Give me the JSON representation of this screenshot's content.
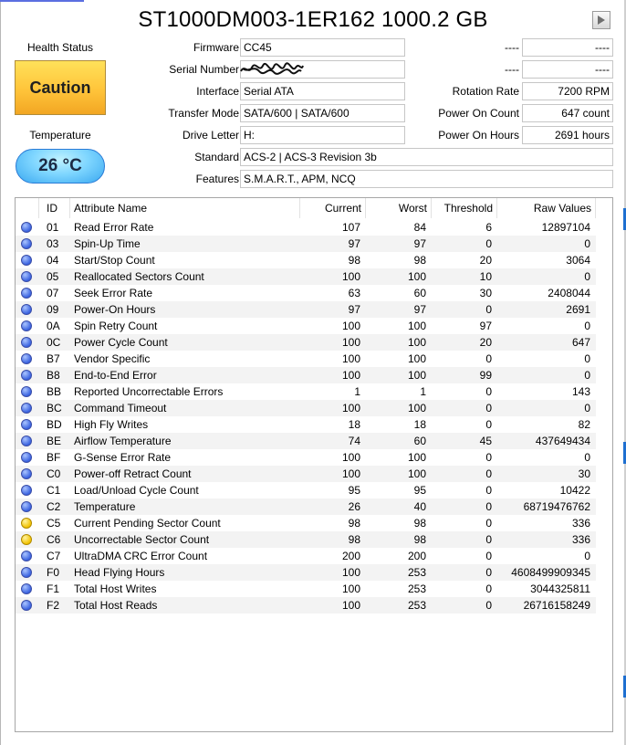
{
  "title": "ST1000DM003-1ER162 1000.2 GB",
  "health": {
    "label": "Health Status",
    "status": "Caution",
    "color": "#ffc43a"
  },
  "temperature": {
    "label": "Temperature",
    "value": "26 °C"
  },
  "info": {
    "firmware": {
      "label": "Firmware",
      "value": "CC45"
    },
    "serial": {
      "label": "Serial Number",
      "value": ""
    },
    "interface": {
      "label": "Interface",
      "value": "Serial ATA"
    },
    "transfer_mode": {
      "label": "Transfer Mode",
      "value": "SATA/600 | SATA/600"
    },
    "drive_letter": {
      "label": "Drive Letter",
      "value": "H:"
    },
    "standard": {
      "label": "Standard",
      "value": "ACS-2 | ACS-3 Revision 3b"
    },
    "features": {
      "label": "Features",
      "value": "S.M.A.R.T., APM, NCQ"
    }
  },
  "right_info": {
    "blank1": {
      "label": "----",
      "value": "----"
    },
    "blank2": {
      "label": "----",
      "value": "----"
    },
    "rotation_rate": {
      "label": "Rotation Rate",
      "value": "7200 RPM"
    },
    "power_on_count": {
      "label": "Power On Count",
      "value": "647 count"
    },
    "power_on_hours": {
      "label": "Power On Hours",
      "value": "2691 hours"
    }
  },
  "table": {
    "columns": [
      "ID",
      "Attribute Name",
      "Current",
      "Worst",
      "Threshold",
      "Raw Values"
    ],
    "rows": [
      {
        "status": "good",
        "id": "01",
        "name": "Read Error Rate",
        "current": "107",
        "worst": "84",
        "threshold": "6",
        "raw": "12897104"
      },
      {
        "status": "good",
        "id": "03",
        "name": "Spin-Up Time",
        "current": "97",
        "worst": "97",
        "threshold": "0",
        "raw": "0"
      },
      {
        "status": "good",
        "id": "04",
        "name": "Start/Stop Count",
        "current": "98",
        "worst": "98",
        "threshold": "20",
        "raw": "3064"
      },
      {
        "status": "good",
        "id": "05",
        "name": "Reallocated Sectors Count",
        "current": "100",
        "worst": "100",
        "threshold": "10",
        "raw": "0"
      },
      {
        "status": "good",
        "id": "07",
        "name": "Seek Error Rate",
        "current": "63",
        "worst": "60",
        "threshold": "30",
        "raw": "2408044"
      },
      {
        "status": "good",
        "id": "09",
        "name": "Power-On Hours",
        "current": "97",
        "worst": "97",
        "threshold": "0",
        "raw": "2691"
      },
      {
        "status": "good",
        "id": "0A",
        "name": "Spin Retry Count",
        "current": "100",
        "worst": "100",
        "threshold": "97",
        "raw": "0"
      },
      {
        "status": "good",
        "id": "0C",
        "name": "Power Cycle Count",
        "current": "100",
        "worst": "100",
        "threshold": "20",
        "raw": "647"
      },
      {
        "status": "good",
        "id": "B7",
        "name": "Vendor Specific",
        "current": "100",
        "worst": "100",
        "threshold": "0",
        "raw": "0"
      },
      {
        "status": "good",
        "id": "B8",
        "name": "End-to-End Error",
        "current": "100",
        "worst": "100",
        "threshold": "99",
        "raw": "0"
      },
      {
        "status": "good",
        "id": "BB",
        "name": "Reported Uncorrectable Errors",
        "current": "1",
        "worst": "1",
        "threshold": "0",
        "raw": "143"
      },
      {
        "status": "good",
        "id": "BC",
        "name": "Command Timeout",
        "current": "100",
        "worst": "100",
        "threshold": "0",
        "raw": "0"
      },
      {
        "status": "good",
        "id": "BD",
        "name": "High Fly Writes",
        "current": "18",
        "worst": "18",
        "threshold": "0",
        "raw": "82"
      },
      {
        "status": "good",
        "id": "BE",
        "name": "Airflow Temperature",
        "current": "74",
        "worst": "60",
        "threshold": "45",
        "raw": "437649434"
      },
      {
        "status": "good",
        "id": "BF",
        "name": "G-Sense Error Rate",
        "current": "100",
        "worst": "100",
        "threshold": "0",
        "raw": "0"
      },
      {
        "status": "good",
        "id": "C0",
        "name": "Power-off Retract Count",
        "current": "100",
        "worst": "100",
        "threshold": "0",
        "raw": "30"
      },
      {
        "status": "good",
        "id": "C1",
        "name": "Load/Unload Cycle Count",
        "current": "95",
        "worst": "95",
        "threshold": "0",
        "raw": "10422"
      },
      {
        "status": "good",
        "id": "C2",
        "name": "Temperature",
        "current": "26",
        "worst": "40",
        "threshold": "0",
        "raw": "68719476762"
      },
      {
        "status": "caution",
        "id": "C5",
        "name": "Current Pending Sector Count",
        "current": "98",
        "worst": "98",
        "threshold": "0",
        "raw": "336"
      },
      {
        "status": "caution",
        "id": "C6",
        "name": "Uncorrectable Sector Count",
        "current": "98",
        "worst": "98",
        "threshold": "0",
        "raw": "336"
      },
      {
        "status": "good",
        "id": "C7",
        "name": "UltraDMA CRC Error Count",
        "current": "200",
        "worst": "200",
        "threshold": "0",
        "raw": "0"
      },
      {
        "status": "good",
        "id": "F0",
        "name": "Head Flying Hours",
        "current": "100",
        "worst": "253",
        "threshold": "0",
        "raw": "4608499909345"
      },
      {
        "status": "good",
        "id": "F1",
        "name": "Total Host Writes",
        "current": "100",
        "worst": "253",
        "threshold": "0",
        "raw": "3044325811"
      },
      {
        "status": "good",
        "id": "F2",
        "name": "Total Host Reads",
        "current": "100",
        "worst": "253",
        "threshold": "0",
        "raw": "26716158249"
      }
    ]
  },
  "status_colors": {
    "good": "#3a63e0",
    "caution": "#f2c200"
  },
  "icons": {
    "play": "play-triangle-icon",
    "status": "status-dot-icon"
  }
}
